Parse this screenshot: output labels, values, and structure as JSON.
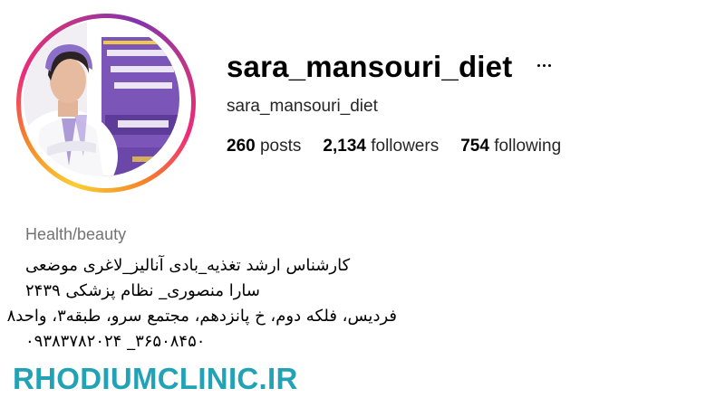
{
  "profile": {
    "username": "sara_mansouri_diet",
    "full_name": "sara_mansouri_diet",
    "more_icon": "more-horizontal-icon",
    "stats": {
      "posts_count": "260",
      "posts_label": "posts",
      "followers_count": "2,134",
      "followers_label": "followers",
      "following_count": "754",
      "following_label": "following"
    },
    "category": "Health/beauty",
    "bio_lines": [
      "کارشناس ارشد تغذیه_بادی آنالیز_لاغری موضعی",
      "سارا منصوری_ نظام پزشکی ۲۴۳۹",
      "فردیس، فلکه دوم، خ پانزدهم، مجتمع سرو، طبقه۳، واحد۸",
      "۰۹۳۸۳۷۸۲۰۲۴ _۳۶۵۰۸۴۵۰"
    ]
  },
  "watermark": "RHODIUMCLINIC.IR",
  "colors": {
    "watermark": "#22a3b5",
    "category": "#737373",
    "ring_gradient": [
      "#f9ce34",
      "#f58529",
      "#ee2a7b",
      "#c13584",
      "#8134af"
    ]
  }
}
